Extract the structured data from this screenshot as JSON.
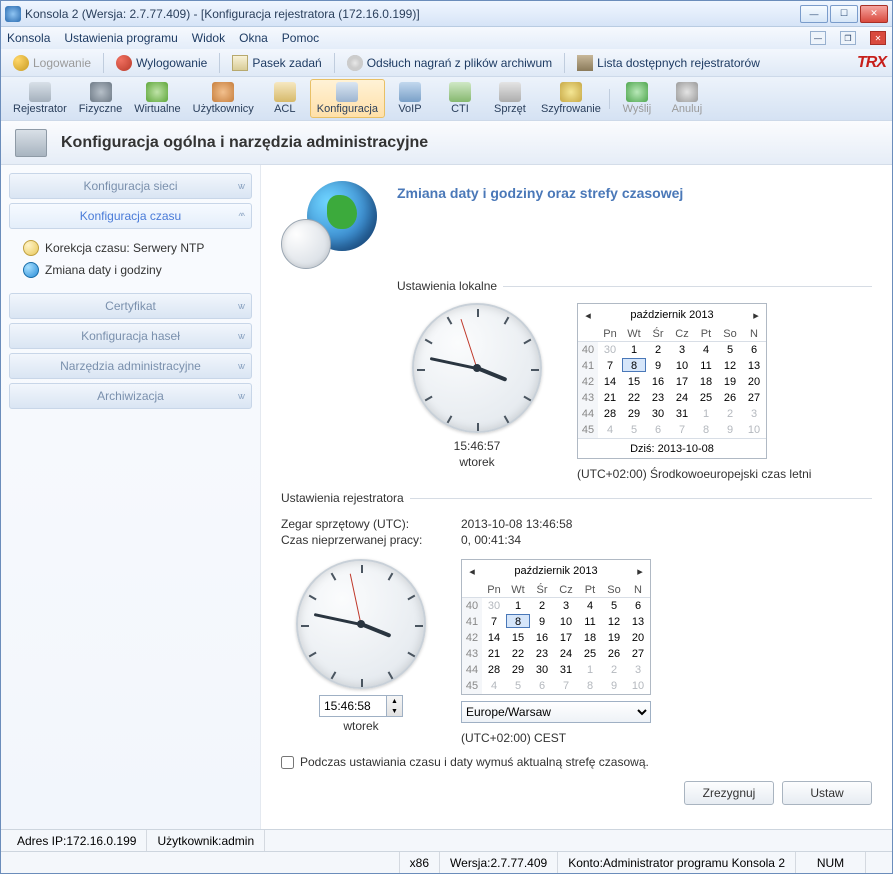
{
  "window": {
    "title": "Konsola 2 (Wersja:  2.7.77.409) - [Konfiguracja rejestratora (172.16.0.199)]"
  },
  "menubar": [
    "Konsola",
    "Ustawienia programu",
    "Widok",
    "Okna",
    "Pomoc"
  ],
  "toolbar1": {
    "login": "Logowanie",
    "logout": "Wylogowanie",
    "taskbar": "Pasek zadań",
    "archive": "Odsłuch nagrań z plików archiwum",
    "recorders": "Lista dostępnych rejestratorów",
    "logo": "TRX"
  },
  "toolbar2": [
    "Rejestrator",
    "Fizyczne",
    "Wirtualne",
    "Użytkownicy",
    "ACL",
    "Konfiguracja",
    "VoIP",
    "CTI",
    "Sprzęt",
    "Szyfrowanie",
    "Wyślij",
    "Anuluj"
  ],
  "page_header": "Konfiguracja ogólna i narzędzia administracyjne",
  "sidebar": {
    "items": [
      {
        "label": "Konfiguracja sieci",
        "expanded": false
      },
      {
        "label": "Konfiguracja czasu",
        "expanded": true,
        "children": [
          {
            "label": "Korekcja czasu: Serwery NTP"
          },
          {
            "label": "Zmiana daty i godziny"
          }
        ]
      },
      {
        "label": "Certyfikat",
        "expanded": false
      },
      {
        "label": "Konfiguracja haseł",
        "expanded": false
      },
      {
        "label": "Narzędzia administracyjne",
        "expanded": false
      },
      {
        "label": "Archiwizacja",
        "expanded": false
      }
    ]
  },
  "content": {
    "title": "Zmiana daty i godziny oraz strefy czasowej",
    "local_legend": "Ustawienia lokalne",
    "rec_legend": "Ustawienia rejestratora",
    "clock1_time": "15:46:57",
    "clock1_day": "wtorek",
    "clock2_time": "15:46:58",
    "clock2_day": "wtorek",
    "tz_local": "(UTC+02:00) Środkowoeuropejski czas letni",
    "hw_clock_label": "Zegar sprzętowy (UTC):",
    "hw_clock_value": "2013-10-08 13:46:58",
    "uptime_label": "Czas nieprzerwanej pracy:",
    "uptime_value": "0, 00:41:34",
    "tz_select": "Europe/Warsaw",
    "tz_rec": "(UTC+02:00) CEST",
    "force_tz": "Podczas ustawiania czasu i daty wymuś aktualną strefę czasową.",
    "btn_cancel": "Zrezygnuj",
    "btn_set": "Ustaw"
  },
  "calendar": {
    "title": "październik 2013",
    "dow": [
      "Pn",
      "Wt",
      "Śr",
      "Cz",
      "Pt",
      "So",
      "N"
    ],
    "weeks": [
      {
        "wk": "40",
        "days": [
          {
            "d": "30",
            "dim": true
          },
          {
            "d": "1"
          },
          {
            "d": "2"
          },
          {
            "d": "3"
          },
          {
            "d": "4"
          },
          {
            "d": "5"
          },
          {
            "d": "6"
          }
        ]
      },
      {
        "wk": "41",
        "days": [
          {
            "d": "7"
          },
          {
            "d": "8",
            "sel": true
          },
          {
            "d": "9"
          },
          {
            "d": "10"
          },
          {
            "d": "11"
          },
          {
            "d": "12"
          },
          {
            "d": "13"
          }
        ]
      },
      {
        "wk": "42",
        "days": [
          {
            "d": "14"
          },
          {
            "d": "15"
          },
          {
            "d": "16"
          },
          {
            "d": "17"
          },
          {
            "d": "18"
          },
          {
            "d": "19"
          },
          {
            "d": "20"
          }
        ]
      },
      {
        "wk": "43",
        "days": [
          {
            "d": "21"
          },
          {
            "d": "22"
          },
          {
            "d": "23"
          },
          {
            "d": "24"
          },
          {
            "d": "25"
          },
          {
            "d": "26"
          },
          {
            "d": "27"
          }
        ]
      },
      {
        "wk": "44",
        "days": [
          {
            "d": "28"
          },
          {
            "d": "29"
          },
          {
            "d": "30"
          },
          {
            "d": "31"
          },
          {
            "d": "1",
            "dim": true
          },
          {
            "d": "2",
            "dim": true
          },
          {
            "d": "3",
            "dim": true
          }
        ]
      },
      {
        "wk": "45",
        "days": [
          {
            "d": "4",
            "dim": true
          },
          {
            "d": "5",
            "dim": true
          },
          {
            "d": "6",
            "dim": true
          },
          {
            "d": "7",
            "dim": true
          },
          {
            "d": "8",
            "dim": true
          },
          {
            "d": "9",
            "dim": true
          },
          {
            "d": "10",
            "dim": true
          }
        ]
      }
    ],
    "today": "Dziś: 2013-10-08"
  },
  "status1": {
    "ip_label": "Adres IP: ",
    "ip": "172.16.0.199",
    "user_label": "Użytkownik: ",
    "user": "admin"
  },
  "status2": {
    "arch": "x86",
    "ver_label": "Wersja: ",
    "ver": "2.7.77.409",
    "acct_label": "Konto: ",
    "acct": "Administrator programu Konsola 2",
    "num": "NUM"
  }
}
